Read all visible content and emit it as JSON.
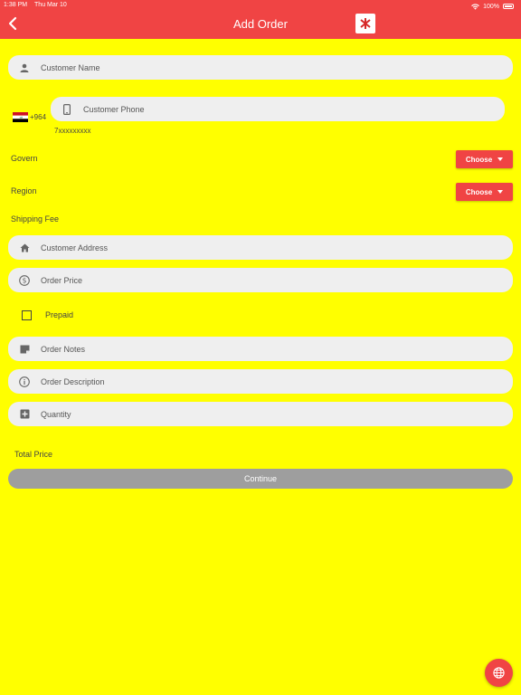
{
  "status_bar": {
    "time": "1:38 PM",
    "date": "Thu Mar 10",
    "battery": "100%"
  },
  "header": {
    "title": "Add Order"
  },
  "form": {
    "customer_name_placeholder": "Customer Name",
    "phone_prefix": "+964",
    "customer_phone_placeholder": "Customer Phone",
    "phone_hint": "7xxxxxxxxx",
    "govern_label": "Govern",
    "govern_choose": "Choose",
    "region_label": "Region",
    "region_choose": "Choose",
    "shipping_fee_label": "Shipping Fee",
    "address_placeholder": "Customer Address",
    "order_price_placeholder": "Order Price",
    "prepaid_label": "Prepaid",
    "order_notes_placeholder": "Order Notes",
    "order_description_placeholder": "Order Description",
    "quantity_placeholder": "Quantity",
    "total_price_label": "Total Price",
    "continue_label": "Continue"
  },
  "colors": {
    "background": "#ffff00",
    "accent": "#f04444",
    "field": "#efefef",
    "button_disabled": "#9e9e9e"
  },
  "icons": [
    "back-icon",
    "person-icon",
    "phone-icon",
    "home-icon",
    "dollar-icon",
    "notes-icon",
    "info-icon",
    "plus-square-icon",
    "globe-icon",
    "iraq-flag-icon",
    "wifi-icon",
    "battery-icon"
  ]
}
